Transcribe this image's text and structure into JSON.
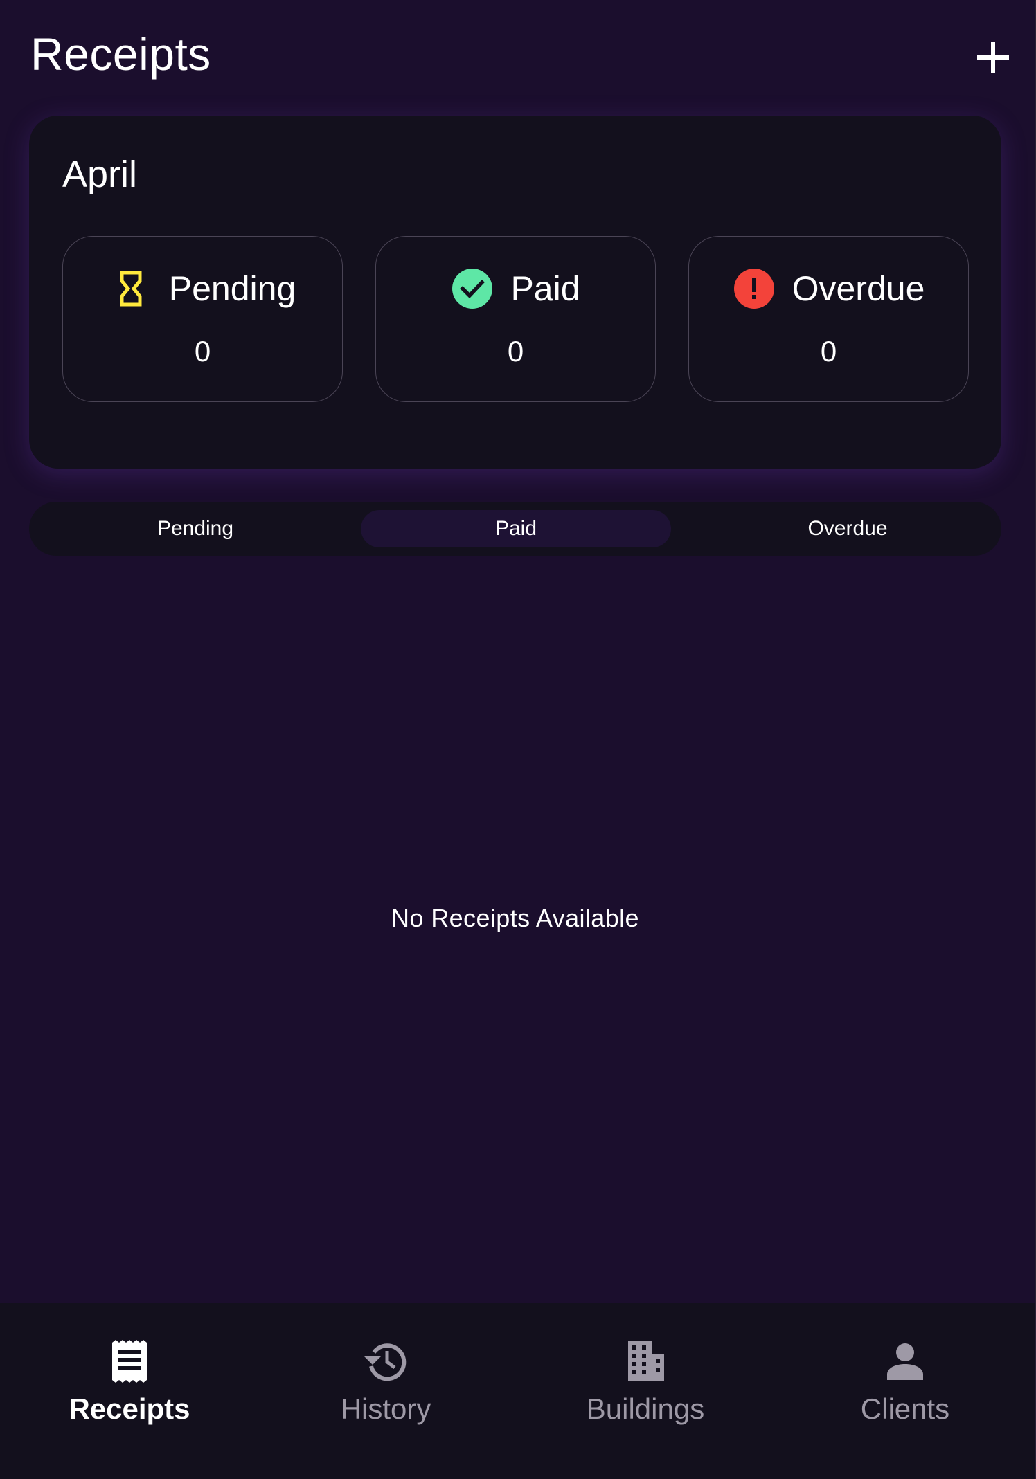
{
  "header": {
    "title": "Receipts",
    "add_icon": "plus-icon"
  },
  "summary": {
    "month": "April",
    "stats": [
      {
        "label": "Pending",
        "count": "0",
        "icon": "hourglass-icon",
        "color": "#ffe93d"
      },
      {
        "label": "Paid",
        "count": "0",
        "icon": "check-circle-icon",
        "color": "#5ee7a6"
      },
      {
        "label": "Overdue",
        "count": "0",
        "icon": "error-circle-icon",
        "color": "#f3433a"
      }
    ]
  },
  "tabs": {
    "items": [
      "Pending",
      "Paid",
      "Overdue"
    ],
    "selected": "Paid"
  },
  "empty_state": "No Receipts Available",
  "bottom_nav": {
    "active": "Receipts",
    "items": [
      {
        "label": "Receipts",
        "icon": "receipt-icon"
      },
      {
        "label": "History",
        "icon": "history-icon"
      },
      {
        "label": "Buildings",
        "icon": "building-icon"
      },
      {
        "label": "Clients",
        "icon": "person-icon"
      }
    ]
  },
  "colors": {
    "background": "#1b0e2d",
    "card": "#13101d",
    "selected_tab": "#1e1234",
    "inactive_nav": "#9e99a6"
  }
}
